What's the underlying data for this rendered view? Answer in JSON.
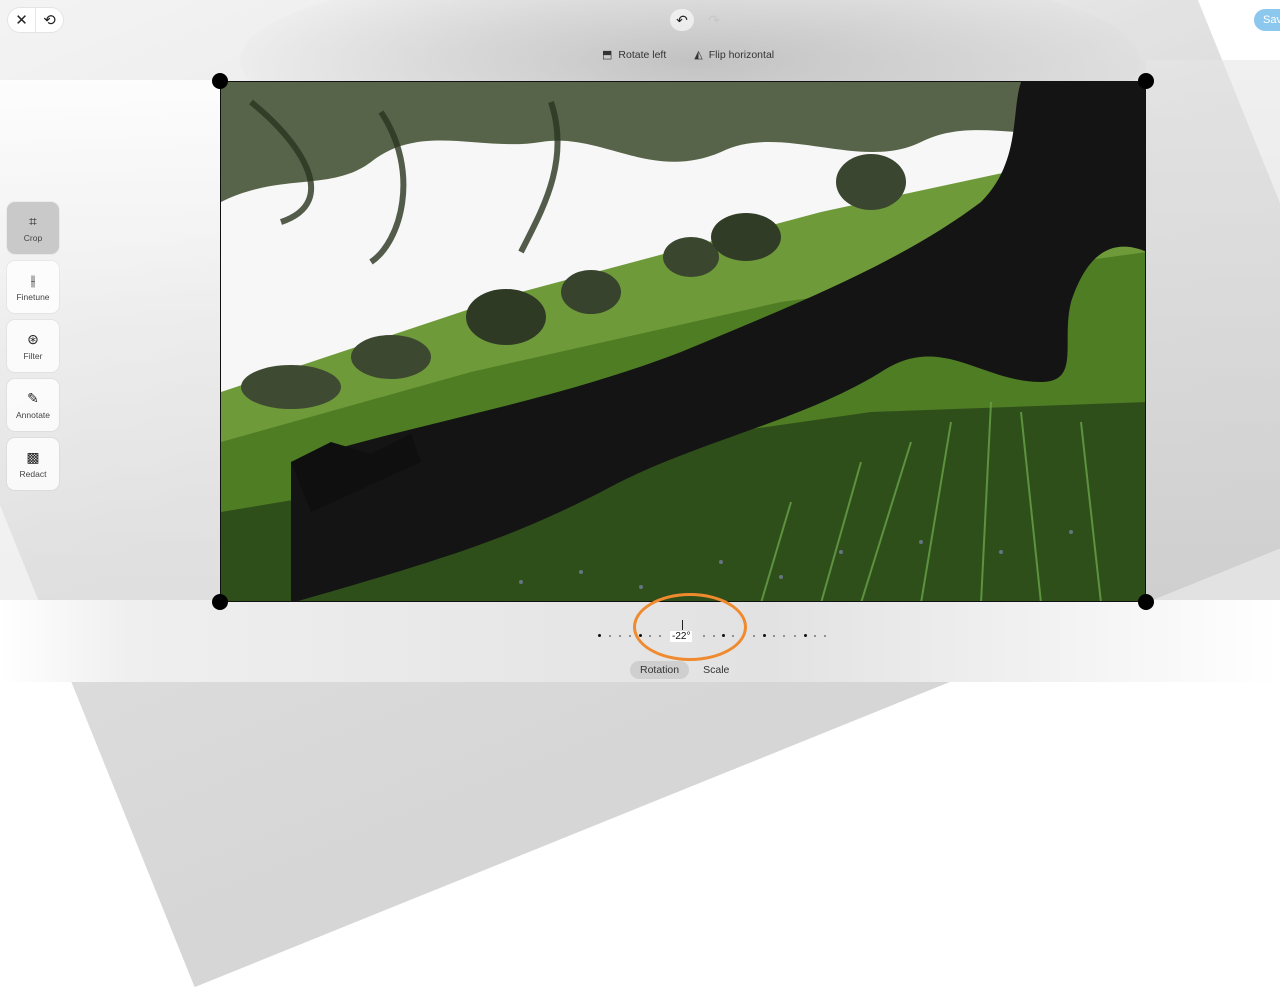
{
  "topbar": {
    "close_icon": "close-icon",
    "history_icon": "history-icon",
    "undo_icon": "undo-icon",
    "redo_icon": "redo-icon",
    "save_label": "Save"
  },
  "crop_tools": [
    {
      "label": "Rotate left",
      "icon": "rotate-left-icon"
    },
    {
      "label": "Flip horizontal",
      "icon": "flip-horizontal-icon"
    }
  ],
  "sidebar": {
    "items": [
      {
        "label": "Crop",
        "icon": "crop-icon",
        "active": true
      },
      {
        "label": "Finetune",
        "icon": "sliders-icon",
        "active": false
      },
      {
        "label": "Filter",
        "icon": "filter-circles-icon",
        "active": false
      },
      {
        "label": "Annotate",
        "icon": "pencil-icon",
        "active": false
      },
      {
        "label": "Redact",
        "icon": "redact-hatch-icon",
        "active": false
      }
    ]
  },
  "rotation": {
    "value_label": "-22°",
    "degrees": -22
  },
  "modes": {
    "items": [
      {
        "label": "Rotation",
        "active": true
      },
      {
        "label": "Scale",
        "active": false
      }
    ]
  },
  "colors": {
    "accent": "#8cc8ee",
    "highlight_ring": "#ef8a2e",
    "handle": "#000000"
  }
}
